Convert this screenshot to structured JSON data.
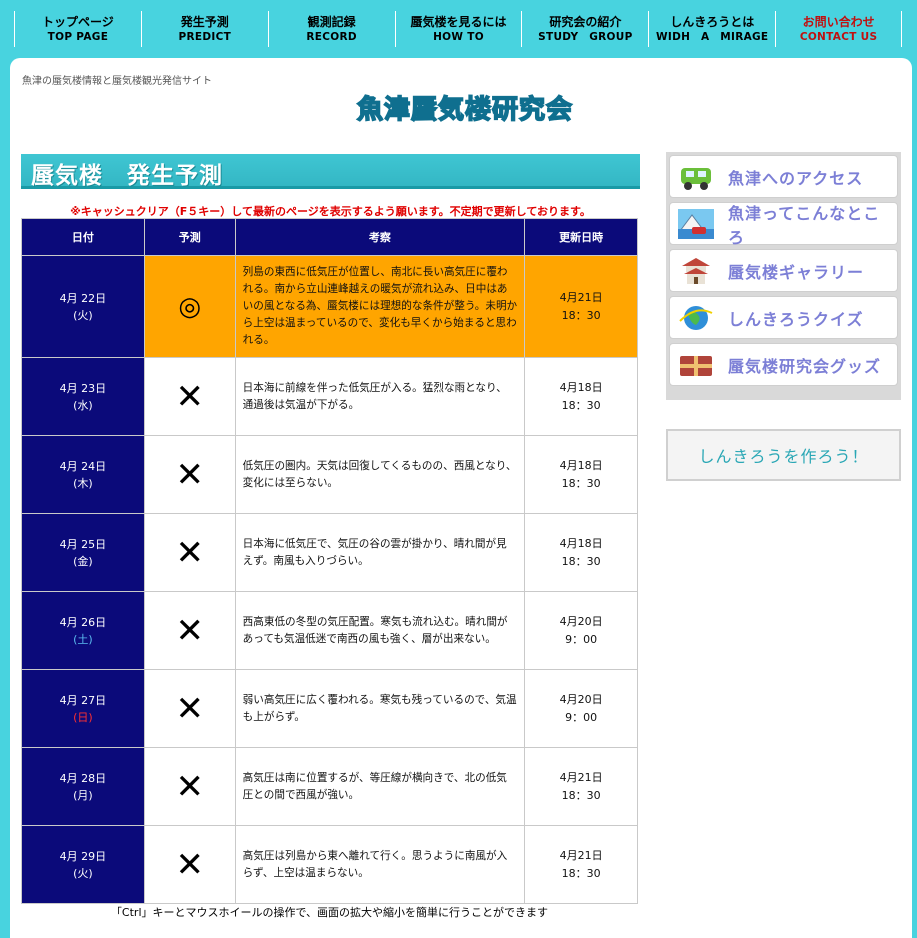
{
  "nav": [
    {
      "jp": "トップページ",
      "en": "TOP PAGE"
    },
    {
      "jp": "発生予測",
      "en": "PREDICT"
    },
    {
      "jp": "観測記録",
      "en": "RECORD"
    },
    {
      "jp": "蜃気楼を見るには",
      "en": "HOW TO"
    },
    {
      "jp": "研究会の紹介",
      "en": "STUDY　GROUP"
    },
    {
      "jp": "しんきろうとは",
      "en": "WIDH　A　MIRAGE"
    },
    {
      "jp": "お問い合わせ",
      "en": "CONTACT US"
    }
  ],
  "site": {
    "tagline": "魚津の蜃気楼情報と蜃気楼観光発信サイト",
    "logo": "魚津蜃気楼研究会"
  },
  "heading": "蜃気楼　発生予測",
  "notice": "※キャッシュクリア（F５キー）して最新のページを表示するよう願います。不定期で更新しております。",
  "table": {
    "headers": [
      "日付",
      "予測",
      "考察",
      "更新日時"
    ],
    "rows": [
      {
        "date": "4月 22日",
        "dow": "(火)",
        "mark": "◎",
        "note": "列島の東西に低気圧が位置し、南北に長い高気圧に覆われる。南から立山連峰越えの暖気が流れ込み、日中はあいの風となる為、蜃気楼には理想的な条件が整う。未明から上空は温まっているので、変化も早くから始まると思われる。",
        "upd_date": "4月21日",
        "upd_time": "18：30"
      },
      {
        "date": "4月 23日",
        "dow": "(水)",
        "mark": "✕",
        "note": "日本海に前線を伴った低気圧が入る。猛烈な雨となり、通過後は気温が下がる。",
        "upd_date": "4月18日",
        "upd_time": "18：30"
      },
      {
        "date": "4月 24日",
        "dow": "(木)",
        "mark": "✕",
        "note": "低気圧の圏内。天気は回復してくるものの、西風となり、変化には至らない。",
        "upd_date": "4月18日",
        "upd_time": "18：30"
      },
      {
        "date": "4月 25日",
        "dow": "(金)",
        "mark": "✕",
        "note": "日本海に低気圧で、気圧の谷の雲が掛かり、晴れ間が見えず。南風も入りづらい。",
        "upd_date": "4月18日",
        "upd_time": "18：30"
      },
      {
        "date": "4月 26日",
        "dow": "(土)",
        "mark": "✕",
        "note": "西高東低の冬型の気圧配置。寒気も流れ込む。晴れ間があっても気温低迷で南西の風も強く、層が出来ない。",
        "upd_date": "4月20日",
        "upd_time": "9：00"
      },
      {
        "date": "4月 27日",
        "dow": "(日)",
        "mark": "✕",
        "note": "弱い高気圧に広く覆われる。寒気も残っているので、気温も上がらず。",
        "upd_date": "4月20日",
        "upd_time": "9：00"
      },
      {
        "date": "4月 28日",
        "dow": "(月)",
        "mark": "✕",
        "note": "高気圧は南に位置するが、等圧線が横向きで、北の低気圧との間で西風が強い。",
        "upd_date": "4月21日",
        "upd_time": "18：30"
      },
      {
        "date": "4月 29日",
        "dow": "(火)",
        "mark": "✕",
        "note": "高気圧は列島から東へ離れて行く。思うように南風が入らず、上空は温まらない。",
        "upd_date": "4月21日",
        "upd_time": "18：30"
      }
    ]
  },
  "footer_note": "「Ctrl」キーとマウスホイールの操作で、画面の拡大や縮小を簡単に行うことができます",
  "sidebar": [
    {
      "label": "魚津へのアクセス",
      "icon": "car-icon"
    },
    {
      "label": "魚津ってこんなところ",
      "icon": "landscape-icon"
    },
    {
      "label": "蜃気楼ギャラリー",
      "icon": "castle-icon"
    },
    {
      "label": "しんきろうクイズ",
      "icon": "globe-icon"
    },
    {
      "label": "蜃気楼研究会グッズ",
      "icon": "gift-icon"
    }
  ],
  "make_button": "しんきろうを作ろう！",
  "colors": {
    "background": "#48d3df",
    "table_header": "#0b0a7a",
    "highlight": "#ffa500",
    "notice": "#e00000"
  }
}
